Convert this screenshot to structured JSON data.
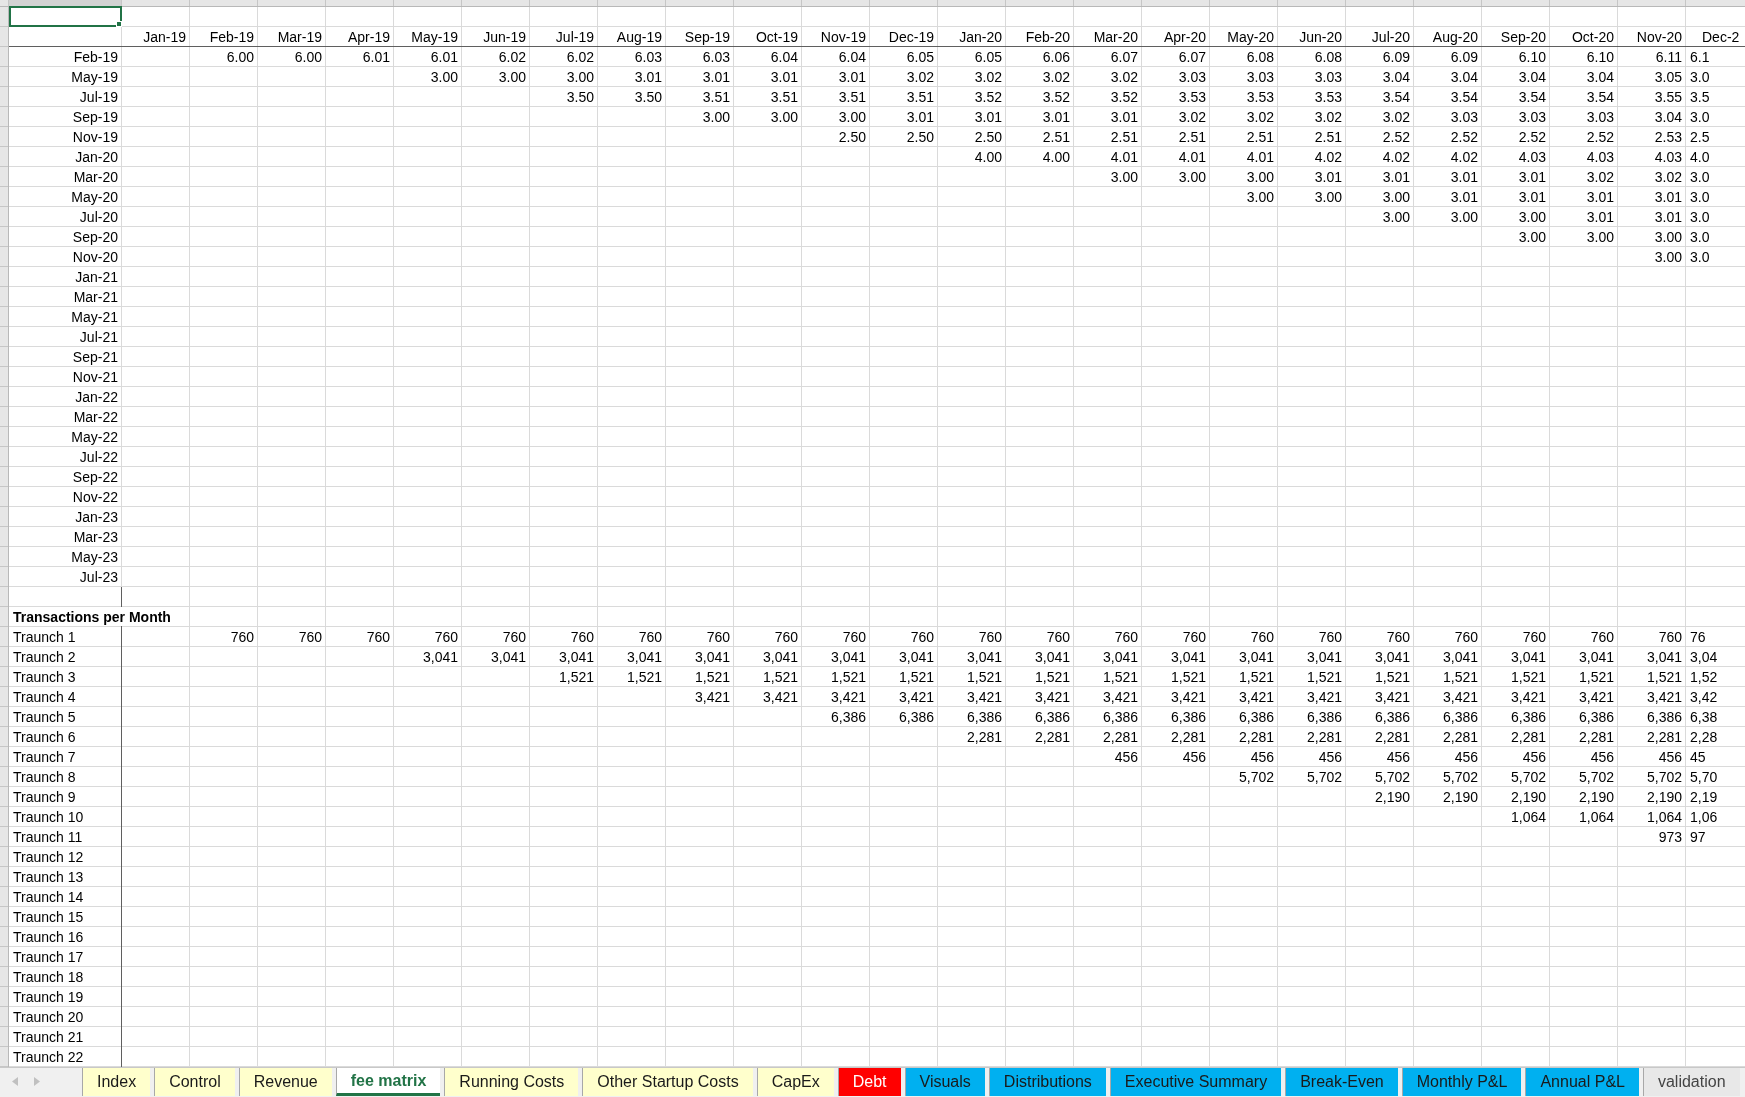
{
  "active_cell": {
    "selected": true
  },
  "fee_matrix": {
    "columns": [
      "Jan-19",
      "Feb-19",
      "Mar-19",
      "Apr-19",
      "May-19",
      "Jun-19",
      "Jul-19",
      "Aug-19",
      "Sep-19",
      "Oct-19",
      "Nov-19",
      "Dec-19",
      "Jan-20",
      "Feb-20",
      "Mar-20",
      "Apr-20",
      "May-20",
      "Jun-20",
      "Jul-20",
      "Aug-20",
      "Sep-20",
      "Oct-20",
      "Nov-20",
      "Dec-2"
    ],
    "rows": [
      {
        "label": "Feb-19",
        "values": [
          "6.00",
          "6.00",
          "6.01",
          "6.01",
          "6.02",
          "6.02",
          "6.03",
          "6.03",
          "6.04",
          "6.04",
          "6.05",
          "6.05",
          "6.06",
          "6.07",
          "6.07",
          "6.08",
          "6.08",
          "6.09",
          "6.09",
          "6.10",
          "6.10",
          "6.11",
          "6.1"
        ]
      },
      {
        "label": "May-19",
        "values": [
          "3.00",
          "3.00",
          "3.00",
          "3.01",
          "3.01",
          "3.01",
          "3.01",
          "3.02",
          "3.02",
          "3.02",
          "3.02",
          "3.03",
          "3.03",
          "3.03",
          "3.04",
          "3.04",
          "3.04",
          "3.04",
          "3.05",
          "3.0"
        ]
      },
      {
        "label": "Jul-19",
        "values": [
          "3.50",
          "3.50",
          "3.51",
          "3.51",
          "3.51",
          "3.51",
          "3.52",
          "3.52",
          "3.52",
          "3.53",
          "3.53",
          "3.53",
          "3.54",
          "3.54",
          "3.54",
          "3.54",
          "3.55",
          "3.5"
        ]
      },
      {
        "label": "Sep-19",
        "values": [
          "3.00",
          "3.00",
          "3.00",
          "3.01",
          "3.01",
          "3.01",
          "3.01",
          "3.02",
          "3.02",
          "3.02",
          "3.02",
          "3.03",
          "3.03",
          "3.03",
          "3.04",
          "3.0"
        ]
      },
      {
        "label": "Nov-19",
        "values": [
          "2.50",
          "2.50",
          "2.50",
          "2.51",
          "2.51",
          "2.51",
          "2.51",
          "2.51",
          "2.52",
          "2.52",
          "2.52",
          "2.52",
          "2.53",
          "2.5"
        ]
      },
      {
        "label": "Jan-20",
        "values": [
          "4.00",
          "4.00",
          "4.01",
          "4.01",
          "4.01",
          "4.02",
          "4.02",
          "4.02",
          "4.03",
          "4.03",
          "4.03",
          "4.0"
        ]
      },
      {
        "label": "Mar-20",
        "values": [
          "3.00",
          "3.00",
          "3.00",
          "3.01",
          "3.01",
          "3.01",
          "3.01",
          "3.02",
          "3.02",
          "3.0"
        ]
      },
      {
        "label": "May-20",
        "values": [
          "3.00",
          "3.00",
          "3.00",
          "3.01",
          "3.01",
          "3.01",
          "3.01",
          "3.0"
        ]
      },
      {
        "label": "Jul-20",
        "values": [
          "3.00",
          "3.00",
          "3.00",
          "3.01",
          "3.01",
          "3.0"
        ]
      },
      {
        "label": "Sep-20",
        "values": [
          "3.00",
          "3.00",
          "3.00",
          "3.0"
        ]
      },
      {
        "label": "Nov-20",
        "values": [
          "3.00",
          "3.0"
        ]
      },
      {
        "label": "Jan-21"
      },
      {
        "label": "Mar-21"
      },
      {
        "label": "May-21"
      },
      {
        "label": "Jul-21"
      },
      {
        "label": "Sep-21"
      },
      {
        "label": "Nov-21"
      },
      {
        "label": "Jan-22"
      },
      {
        "label": "Mar-22"
      },
      {
        "label": "May-22"
      },
      {
        "label": "Jul-22"
      },
      {
        "label": "Sep-22"
      },
      {
        "label": "Nov-22"
      },
      {
        "label": "Jan-23"
      },
      {
        "label": "Mar-23"
      },
      {
        "label": "May-23"
      },
      {
        "label": "Jul-23"
      }
    ]
  },
  "transactions": {
    "title": "Transactions per Month",
    "rows": [
      {
        "label": "Traunch 1",
        "values": [
          "760",
          "760",
          "760",
          "760",
          "760",
          "760",
          "760",
          "760",
          "760",
          "760",
          "760",
          "760",
          "760",
          "760",
          "760",
          "760",
          "760",
          "760",
          "760",
          "760",
          "760",
          "760",
          "76"
        ]
      },
      {
        "label": "Traunch 2",
        "values": [
          "3,041",
          "3,041",
          "3,041",
          "3,041",
          "3,041",
          "3,041",
          "3,041",
          "3,041",
          "3,041",
          "3,041",
          "3,041",
          "3,041",
          "3,041",
          "3,041",
          "3,041",
          "3,041",
          "3,041",
          "3,041",
          "3,041",
          "3,04"
        ]
      },
      {
        "label": "Traunch 3",
        "values": [
          "1,521",
          "1,521",
          "1,521",
          "1,521",
          "1,521",
          "1,521",
          "1,521",
          "1,521",
          "1,521",
          "1,521",
          "1,521",
          "1,521",
          "1,521",
          "1,521",
          "1,521",
          "1,521",
          "1,521",
          "1,52"
        ]
      },
      {
        "label": "Traunch 4",
        "values": [
          "3,421",
          "3,421",
          "3,421",
          "3,421",
          "3,421",
          "3,421",
          "3,421",
          "3,421",
          "3,421",
          "3,421",
          "3,421",
          "3,421",
          "3,421",
          "3,421",
          "3,421",
          "3,42"
        ]
      },
      {
        "label": "Traunch 5",
        "values": [
          "6,386",
          "6,386",
          "6,386",
          "6,386",
          "6,386",
          "6,386",
          "6,386",
          "6,386",
          "6,386",
          "6,386",
          "6,386",
          "6,386",
          "6,386",
          "6,38"
        ]
      },
      {
        "label": "Traunch 6",
        "values": [
          "2,281",
          "2,281",
          "2,281",
          "2,281",
          "2,281",
          "2,281",
          "2,281",
          "2,281",
          "2,281",
          "2,281",
          "2,281",
          "2,28"
        ]
      },
      {
        "label": "Traunch 7",
        "values": [
          "456",
          "456",
          "456",
          "456",
          "456",
          "456",
          "456",
          "456",
          "456",
          "45"
        ]
      },
      {
        "label": "Traunch 8",
        "values": [
          "5,702",
          "5,702",
          "5,702",
          "5,702",
          "5,702",
          "5,702",
          "5,702",
          "5,70"
        ]
      },
      {
        "label": "Traunch 9",
        "values": [
          "2,190",
          "2,190",
          "2,190",
          "2,190",
          "2,190",
          "2,19"
        ]
      },
      {
        "label": "Traunch 10",
        "values": [
          "1,064",
          "1,064",
          "1,064",
          "1,06"
        ]
      },
      {
        "label": "Traunch 11",
        "values": [
          "973",
          "97"
        ]
      },
      {
        "label": "Traunch 12"
      },
      {
        "label": "Traunch 13"
      },
      {
        "label": "Traunch 14"
      },
      {
        "label": "Traunch 15"
      },
      {
        "label": "Traunch 16"
      },
      {
        "label": "Traunch 17"
      },
      {
        "label": "Traunch 18"
      },
      {
        "label": "Traunch 19"
      },
      {
        "label": "Traunch 20"
      },
      {
        "label": "Traunch 21"
      },
      {
        "label": "Traunch 22"
      }
    ]
  },
  "sheet_tabs": [
    {
      "label": "Index",
      "selected": false,
      "color": "#ffffcc"
    },
    {
      "label": "Control",
      "selected": false,
      "color": "#ffffcc"
    },
    {
      "label": "Revenue",
      "selected": false,
      "color": "#ffffcc"
    },
    {
      "label": "fee matrix",
      "selected": true
    },
    {
      "label": "Running Costs",
      "selected": false,
      "color": "#ffffcc"
    },
    {
      "label": "Other Startup Costs",
      "selected": false,
      "color": "#ffffcc"
    },
    {
      "label": "CapEx",
      "selected": false,
      "color": "#ffffcc"
    },
    {
      "label": "Debt",
      "selected": false,
      "color": "#ff0000"
    },
    {
      "label": "Visuals",
      "selected": false,
      "color": "#00b0f0"
    },
    {
      "label": "Distributions",
      "selected": false,
      "color": "#00b0f0"
    },
    {
      "label": "Executive Summary",
      "selected": false,
      "color": "#00b0f0"
    },
    {
      "label": "Break-Even",
      "selected": false,
      "color": "#00b0f0"
    },
    {
      "label": "Monthly P&L",
      "selected": false,
      "color": "#00b0f0"
    },
    {
      "label": "Annual P&L",
      "selected": false,
      "color": "#00b0f0"
    },
    {
      "label": "validation",
      "selected": false
    }
  ]
}
